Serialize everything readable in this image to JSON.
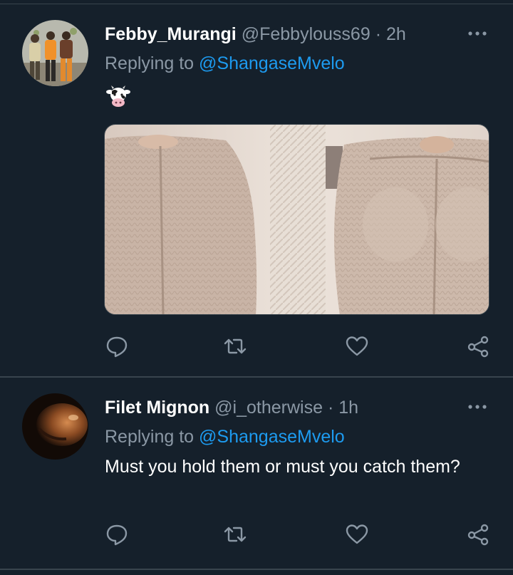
{
  "tweets": [
    {
      "display_name": "Febby_Murangi",
      "handle": "@Febbylouss69",
      "separator": "·",
      "time": "2h",
      "replying_prefix": "Replying to",
      "replying_to": "@ShangaseMvelo",
      "emoji": "cow-face-emoji",
      "media": "image-two-sweaters"
    },
    {
      "display_name": "Filet Mignon",
      "handle": "@i_otherwise",
      "separator": "·",
      "time": "1h",
      "replying_prefix": "Replying to",
      "replying_to": "@ShangaseMvelo",
      "text": "Must you hold them or must you catch them?"
    }
  ],
  "actions": {
    "icons": [
      "reply-icon",
      "retweet-icon",
      "like-icon",
      "share-icon"
    ]
  },
  "colors": {
    "background": "#15202b",
    "secondary_text": "#8b98a5",
    "accent": "#1d9bf0",
    "divider": "#38444d"
  }
}
